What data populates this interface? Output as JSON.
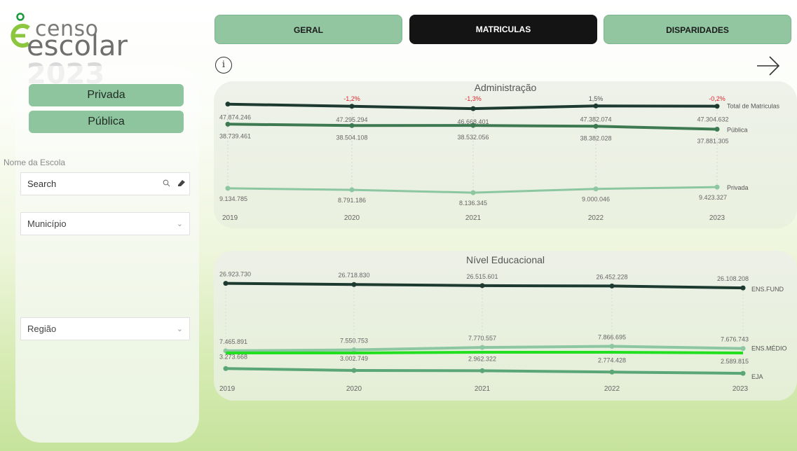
{
  "logo": {
    "censo": "censo",
    "escolar": "escolar",
    "year": "2023"
  },
  "tabs": [
    {
      "label": "GERAL",
      "active": false
    },
    {
      "label": "MATRICULAS",
      "active": true
    },
    {
      "label": "DISPARIDADES",
      "active": false
    }
  ],
  "sidebar": {
    "buttons": [
      "Privada",
      "Pública"
    ],
    "filter_label": "Nome da Escola",
    "search_placeholder": "Search",
    "municipio": "Município",
    "regiao": "Região"
  },
  "colors": {
    "total": "#1c3a30",
    "publica": "#3d7a52",
    "privada": "#8cc7a1",
    "fund": "#1c3a30",
    "medio_line1": "#8cc7a1",
    "medio_line2": "#22e01f",
    "eja": "#5aa677",
    "negative": "#e0252b",
    "positive": "#555555"
  },
  "chart_data": [
    {
      "type": "line",
      "title": "Administração",
      "categories": [
        "2019",
        "2020",
        "2021",
        "2022",
        "2023"
      ],
      "series": [
        {
          "name": "Total de Matriculas",
          "values": [
            47874246,
            47295294,
            46668401,
            47382074,
            47304632
          ],
          "labels": [
            "47.874.246",
            "47.295.294",
            "46.668.401",
            "47.382.074",
            "47.304.632"
          ]
        },
        {
          "name": "Pública",
          "values": [
            38739461,
            38504108,
            38532056,
            38382028,
            37881305
          ],
          "labels": [
            "38.739.461",
            "38.504.108",
            "38.532.056",
            "38.382.028",
            "37.881.305"
          ]
        },
        {
          "name": "Privada",
          "values": [
            9134785,
            8791186,
            8136345,
            9000046,
            9423327
          ],
          "labels": [
            "9.134.785",
            "8.791.186",
            "8.136.345",
            "9.000.046",
            "9.423.327"
          ]
        }
      ],
      "variation_labels": [
        "",
        "-1,2%",
        "-1,3%",
        "1,5%",
        "-0,2%"
      ]
    },
    {
      "type": "line",
      "title": "Nível Educacional",
      "categories": [
        "2019",
        "2020",
        "2021",
        "2022",
        "2023"
      ],
      "series": [
        {
          "name": "ENS.FUND",
          "values": [
            26923730,
            26718830,
            26515601,
            26452228,
            26108208
          ],
          "labels": [
            "26.923.730",
            "26.718.830",
            "26.515.601",
            "26.452.228",
            "26.108.208"
          ]
        },
        {
          "name": "ENS.MÉDIO",
          "values": [
            7465891,
            7550753,
            7770557,
            7866695,
            7676743
          ],
          "labels": [
            "7.465.891",
            "7.550.753",
            "7.770.557",
            "7.866.695",
            "7.676.743"
          ]
        },
        {
          "name": "EJA",
          "values": [
            3273668,
            3002749,
            2962322,
            2774428,
            2589815
          ],
          "labels": [
            "3.273.668",
            "3.002.749",
            "2.962.322",
            "2.774.428",
            "2.589.815"
          ]
        }
      ]
    }
  ]
}
